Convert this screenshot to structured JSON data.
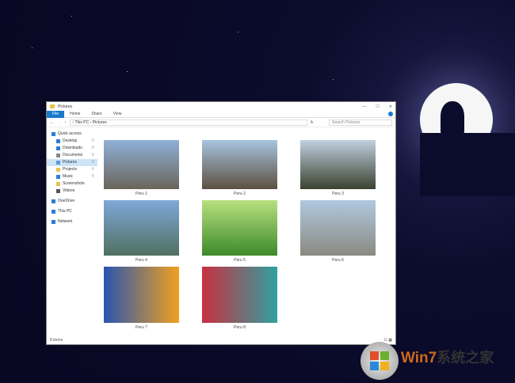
{
  "window": {
    "title": "Pictures",
    "controls": [
      "—",
      "☐",
      "✕"
    ]
  },
  "ribbon": {
    "tabs": [
      "File",
      "Home",
      "Share",
      "View"
    ]
  },
  "address": {
    "path": [
      "This PC",
      "Pictures"
    ],
    "search_placeholder": "Search Pictures"
  },
  "nav": [
    {
      "label": "Quick access",
      "color": "#2b7cd3"
    },
    {
      "label": "Desktop",
      "color": "#2b7cd3",
      "pin": true
    },
    {
      "label": "Downloads",
      "color": "#2b7cd3",
      "pin": true
    },
    {
      "label": "Documents",
      "color": "#888",
      "pin": true
    },
    {
      "label": "Pictures",
      "color": "#5a9bd5",
      "pin": true,
      "selected": true
    },
    {
      "label": "Projects",
      "color": "#e8c050",
      "pin": true
    },
    {
      "label": "Music",
      "color": "#2b7cd3",
      "pin": true
    },
    {
      "label": "Screenshots",
      "color": "#e8c050"
    },
    {
      "label": "Videos",
      "color": "#555"
    },
    {
      "label": "OneDrive",
      "color": "#2b7cd3"
    },
    {
      "label": "This PC",
      "color": "#2b7cd3"
    },
    {
      "label": "Network",
      "color": "#2b7cd3"
    }
  ],
  "files": [
    {
      "name": "Peru 1",
      "colors": [
        "#8fb0d8",
        "#6a655a"
      ]
    },
    {
      "name": "Peru 2",
      "colors": [
        "#a8c4e0",
        "#5c5040"
      ]
    },
    {
      "name": "Peru 3",
      "colors": [
        "#c0d0e0",
        "#3a4230"
      ]
    },
    {
      "name": "Peru 4",
      "colors": [
        "#7fa8d8",
        "#4f7060"
      ]
    },
    {
      "name": "Peru 5",
      "colors": [
        "#b8e080",
        "#3d8a2a"
      ]
    },
    {
      "name": "Peru 6",
      "colors": [
        "#b0c8e0",
        "#8a8a80"
      ]
    },
    {
      "name": "Peru 7",
      "colors": [
        "#2a55b0",
        "#f0a020"
      ]
    },
    {
      "name": "Peru 8",
      "colors": [
        "#c83040",
        "#30a0a0"
      ]
    }
  ],
  "status": {
    "count": "8 items"
  },
  "watermark": {
    "brand": "Win7",
    "suffix": "系统之家"
  }
}
